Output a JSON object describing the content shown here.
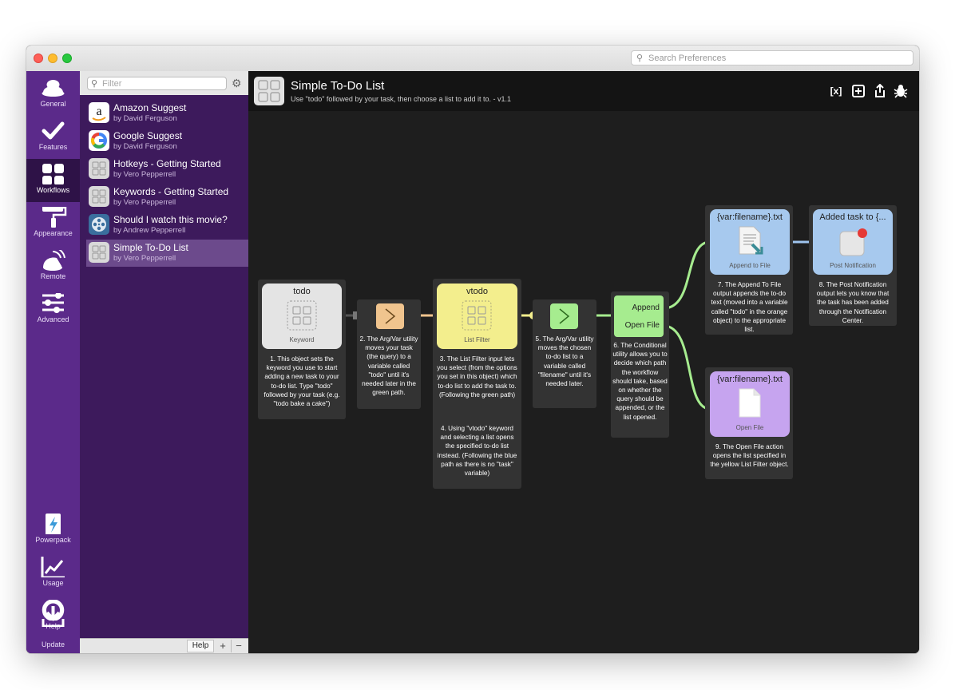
{
  "window": {
    "search_placeholder": "Search Preferences"
  },
  "nav": {
    "items": [
      {
        "label": "General",
        "icon": "hat-icon"
      },
      {
        "label": "Features",
        "icon": "checkmark-icon"
      },
      {
        "label": "Workflows",
        "icon": "grid-icon"
      },
      {
        "label": "Appearance",
        "icon": "paint-roller-icon"
      },
      {
        "label": "Remote",
        "icon": "remote-icon"
      },
      {
        "label": "Advanced",
        "icon": "sliders-icon"
      },
      {
        "label": "Powerpack",
        "icon": "battery-icon"
      },
      {
        "label": "Usage",
        "icon": "chart-icon"
      },
      {
        "label": "Help",
        "icon": "lifebuoy-icon"
      },
      {
        "label": "Update",
        "icon": "download-icon"
      }
    ],
    "active": "Workflows"
  },
  "workflow_list": {
    "filter_placeholder": "Filter",
    "items": [
      {
        "name": "Amazon Suggest",
        "author": "by David Ferguson"
      },
      {
        "name": "Google Suggest",
        "author": "by David Ferguson"
      },
      {
        "name": "Hotkeys - Getting Started",
        "author": "by Vero Pepperrell"
      },
      {
        "name": "Keywords - Getting Started",
        "author": "by Vero Pepperrell"
      },
      {
        "name": "Should I watch this movie?",
        "author": "by Andrew Pepperrell"
      },
      {
        "name": "Simple To-Do List",
        "author": "by Vero Pepperrell"
      }
    ],
    "selected_index": 5,
    "help_label": "Help",
    "add_label": "+",
    "remove_label": "−"
  },
  "canvas": {
    "title": "Simple To-Do List",
    "subtitle": "Use \"todo\" followed by your task, then choose a list to add it to. - v1.1",
    "toolbar": {
      "variables": "[x]",
      "add": "+",
      "share": "share-icon",
      "debug": "bug-icon"
    },
    "objects": {
      "keyword": {
        "title": "todo",
        "sub": "Keyword"
      },
      "list_filter": {
        "title": "vtodo",
        "sub": "List Filter"
      },
      "conditional": {
        "out1": "Append",
        "out2": "Open File"
      },
      "append": {
        "title": "{var:filename}.txt",
        "sub": "Append to File"
      },
      "notify": {
        "title": "Added task to {...",
        "sub": "Post Notification"
      },
      "openfile": {
        "title": "{var:filename}.txt",
        "sub": "Open File"
      }
    },
    "notes": {
      "n1": "1. This object sets the keyword you use to start adding a new task to your to-do list. Type \"todo\" followed by your task (e.g. \"todo bake a cake\")",
      "n2": "2. The Arg/Var utility moves your task (the query) to a variable called \"todo\" until it's needed later in the green path.",
      "n3a": "3. The List Filter input lets you select (from the options you set in this object) which to-do list to add the task to. (Following the green path)",
      "n3b": "4. Using \"vtodo\" keyword and selecting a list opens the specified to-do list instead. (Following the blue path as there is no \"task\" variable)",
      "n5": "5. The Arg/Var utility moves the chosen to-do list to a variable called \"filename\" until it's needed later.",
      "n6": "6. The Conditional utility allows you to decide which path the workflow should take, based on whether the query should be appended, or the list opened.",
      "n7": "7. The Append To File output appends the to-do text (moved into a variable called \"todo\" in the orange object) to the appropriate list.",
      "n8": "8. The Post Notification output lets you know that the task has been added through the Notification Center.",
      "n9": "9. The Open File action opens the list specified in the yellow List Filter object."
    },
    "colors": {
      "keyword": "#e4e4e4",
      "argvar_orange": "#f0c48e",
      "list_filter": "#f3ee8d",
      "argvar_green": "#a6ec8f",
      "conditional": "#a6ec8f",
      "append": "#a7c9ee",
      "notify": "#a7c9ee",
      "openfile": "#c6a4ef",
      "wire_orange": "#f0c48e",
      "wire_yellow": "#f3ee8d",
      "wire_green": "#a6ec8f",
      "wire_blue": "#9fc4ee"
    }
  }
}
